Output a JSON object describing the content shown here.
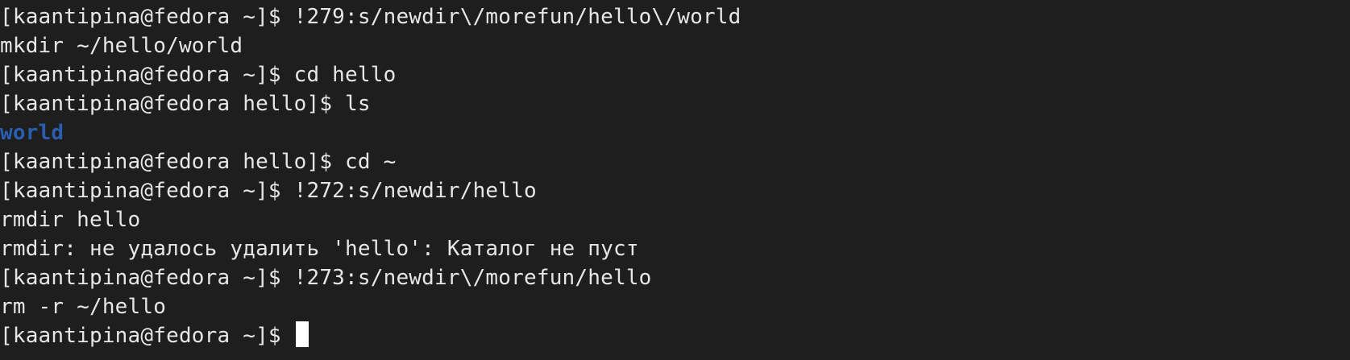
{
  "terminal": {
    "lines": [
      {
        "kind": "prompt",
        "text": "[kaantipina@fedora ~]$ !279:s/newdir\\/morefun/hello\\/world"
      },
      {
        "kind": "output",
        "text": "mkdir ~/hello/world"
      },
      {
        "kind": "prompt",
        "text": "[kaantipina@fedora ~]$ cd hello"
      },
      {
        "kind": "prompt",
        "text": "[kaantipina@fedora hello]$ ls"
      },
      {
        "kind": "dir",
        "text": "world"
      },
      {
        "kind": "prompt",
        "text": "[kaantipina@fedora hello]$ cd ~"
      },
      {
        "kind": "prompt",
        "text": "[kaantipina@fedora ~]$ !272:s/newdir/hello"
      },
      {
        "kind": "output",
        "text": "rmdir hello"
      },
      {
        "kind": "output",
        "text": "rmdir: не удалось удалить 'hello': Каталог не пуст"
      },
      {
        "kind": "prompt",
        "text": "[kaantipina@fedora ~]$ !273:s/newdir\\/morefun/hello"
      },
      {
        "kind": "output",
        "text": "rm -r ~/hello"
      },
      {
        "kind": "prompt",
        "text": "[kaantipina@fedora ~]$ "
      }
    ],
    "colors": {
      "background": "#1e1e1e",
      "foreground": "#e6e6e6",
      "directory": "#2a5fb0",
      "cursor": "#ffffff"
    }
  }
}
